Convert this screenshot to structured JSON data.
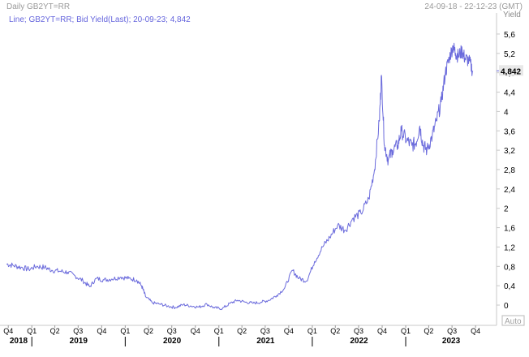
{
  "header": {
    "title": "Daily GB2YT=RR",
    "date_range": "24-09-18 - 22-12-23 (GMT)"
  },
  "legend_text": "Line; GB2YT=RR; Bid Yield(Last); 20-09-23; 4,842",
  "y_unit": "Yield",
  "last_value_label": "4,842",
  "auto_label": "Auto",
  "colors": {
    "series": "#6b6bdc",
    "axis": "#c8c8c8",
    "text": "#000000",
    "header_text": "#9a9a9a",
    "last_label_bg": "#e8e8e8"
  },
  "chart_data": {
    "type": "line",
    "title": "",
    "ylabel": "Yield",
    "ylim": [
      -0.1,
      5.75
    ],
    "y_ticks": [
      "5,6",
      "5,2",
      "4,8",
      "4,4",
      "4",
      "3,6",
      "3,2",
      "2,8",
      "2,4",
      "2",
      "1,6",
      "1,2",
      "0,8",
      "0,4",
      "0"
    ],
    "y_tick_values": [
      5.6,
      5.2,
      4.8,
      4.4,
      4.0,
      3.6,
      3.2,
      2.8,
      2.4,
      2.0,
      1.6,
      1.2,
      0.8,
      0.4,
      0.0
    ],
    "x_start": "2018-09-24",
    "x_end": "2023-12-22",
    "quarter_labels": [
      {
        "label": "Q4",
        "date": "2018-10-01"
      },
      {
        "label": "Q1",
        "date": "2019-01-01"
      },
      {
        "label": "Q2",
        "date": "2019-04-01"
      },
      {
        "label": "Q3",
        "date": "2019-07-01"
      },
      {
        "label": "Q4",
        "date": "2019-10-01"
      },
      {
        "label": "Q1",
        "date": "2020-01-01"
      },
      {
        "label": "Q2",
        "date": "2020-04-01"
      },
      {
        "label": "Q3",
        "date": "2020-07-01"
      },
      {
        "label": "Q4",
        "date": "2020-10-01"
      },
      {
        "label": "Q1",
        "date": "2021-01-01"
      },
      {
        "label": "Q2",
        "date": "2021-04-01"
      },
      {
        "label": "Q3",
        "date": "2021-07-01"
      },
      {
        "label": "Q4",
        "date": "2021-10-01"
      },
      {
        "label": "Q1",
        "date": "2022-01-01"
      },
      {
        "label": "Q2",
        "date": "2022-04-01"
      },
      {
        "label": "Q3",
        "date": "2022-07-01"
      },
      {
        "label": "Q4",
        "date": "2022-10-01"
      },
      {
        "label": "Q1",
        "date": "2023-01-01"
      },
      {
        "label": "Q2",
        "date": "2023-04-01"
      },
      {
        "label": "Q3",
        "date": "2023-07-01"
      },
      {
        "label": "Q4",
        "date": "2023-10-01"
      }
    ],
    "year_labels": [
      {
        "label": "2018",
        "date": "2018-09-24"
      },
      {
        "label": "2019",
        "date": "2019-01-01"
      },
      {
        "label": "2020",
        "date": "2020-01-01"
      },
      {
        "label": "2021",
        "date": "2021-01-01"
      },
      {
        "label": "2022",
        "date": "2022-01-01"
      },
      {
        "label": "2023",
        "date": "2023-01-01"
      }
    ],
    "series": [
      {
        "name": "Bid Yield(Last)",
        "x": [
          "2018-09-24",
          "2018-10-20",
          "2018-11-20",
          "2018-12-20",
          "2019-01-20",
          "2019-02-20",
          "2019-03-20",
          "2019-04-20",
          "2019-05-20",
          "2019-06-20",
          "2019-07-20",
          "2019-08-15",
          "2019-09-10",
          "2019-10-10",
          "2019-11-10",
          "2019-12-15",
          "2020-01-15",
          "2020-02-15",
          "2020-03-05",
          "2020-03-20",
          "2020-04-15",
          "2020-05-15",
          "2020-06-15",
          "2020-07-15",
          "2020-08-15",
          "2020-09-15",
          "2020-10-15",
          "2020-11-15",
          "2020-12-15",
          "2021-01-15",
          "2021-02-15",
          "2021-03-15",
          "2021-04-15",
          "2021-05-15",
          "2021-06-15",
          "2021-07-15",
          "2021-08-15",
          "2021-09-15",
          "2021-10-15",
          "2021-11-10",
          "2021-12-10",
          "2022-01-10",
          "2022-02-10",
          "2022-03-10",
          "2022-04-10",
          "2022-05-10",
          "2022-06-10",
          "2022-07-10",
          "2022-08-10",
          "2022-09-01",
          "2022-09-20",
          "2022-09-28",
          "2022-10-10",
          "2022-10-25",
          "2022-11-10",
          "2022-12-01",
          "2022-12-15",
          "2023-01-05",
          "2023-01-25",
          "2023-02-10",
          "2023-02-25",
          "2023-03-10",
          "2023-03-25",
          "2023-04-15",
          "2023-05-01",
          "2023-05-20",
          "2023-06-05",
          "2023-06-20",
          "2023-07-05",
          "2023-07-15",
          "2023-07-25",
          "2023-08-10",
          "2023-08-20",
          "2023-09-05",
          "2023-09-20"
        ],
        "y": [
          0.85,
          0.82,
          0.78,
          0.74,
          0.8,
          0.78,
          0.72,
          0.7,
          0.68,
          0.6,
          0.5,
          0.38,
          0.55,
          0.52,
          0.54,
          0.58,
          0.55,
          0.52,
          0.4,
          0.18,
          0.05,
          0.02,
          -0.02,
          -0.05,
          0.01,
          -0.02,
          -0.04,
          0.02,
          -0.06,
          -0.07,
          0.04,
          0.1,
          0.06,
          0.04,
          0.06,
          0.1,
          0.2,
          0.35,
          0.72,
          0.55,
          0.5,
          0.9,
          1.2,
          1.4,
          1.65,
          1.55,
          1.8,
          1.9,
          2.2,
          2.8,
          3.8,
          4.75,
          3.3,
          3.0,
          3.2,
          3.3,
          3.6,
          3.4,
          3.3,
          3.35,
          3.7,
          3.3,
          3.2,
          3.5,
          3.8,
          4.2,
          4.8,
          5.1,
          5.35,
          5.2,
          5.15,
          5.25,
          5.1,
          5.05,
          4.84
        ]
      }
    ],
    "grid": false,
    "legend_position": "top-left"
  }
}
